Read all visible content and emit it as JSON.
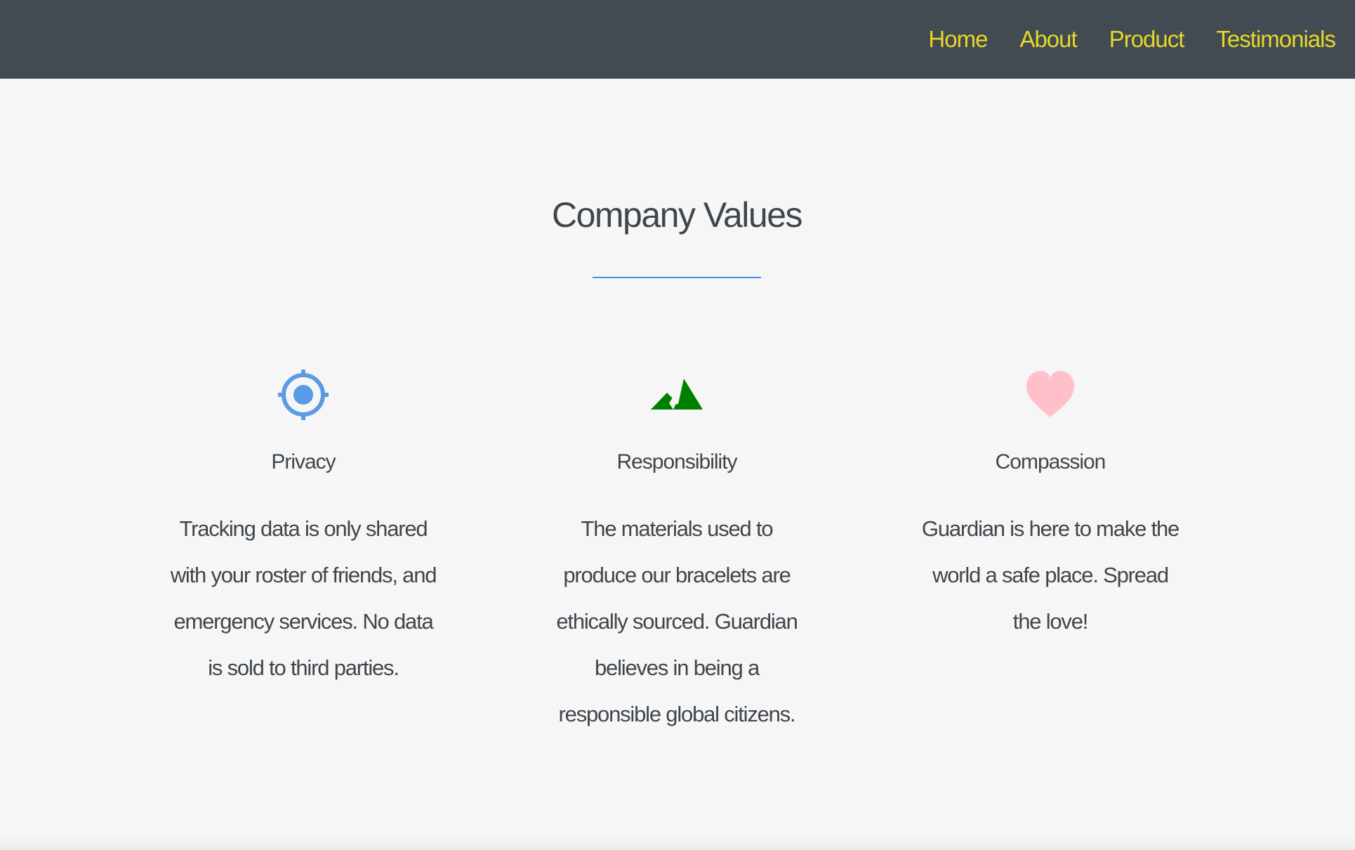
{
  "nav": {
    "links": [
      "Home",
      "About",
      "Product",
      "Testimonials"
    ]
  },
  "values_section": {
    "title": "Company Values",
    "cards": [
      {
        "icon": "crosshair-icon",
        "title": "Privacy",
        "text": "Tracking data is only shared with your roster of friends, and emergency services. No data is sold to third parties."
      },
      {
        "icon": "mountain-icon",
        "title": "Responsibility",
        "text": "The materials used to produce our bracelets are ethically sourced. Guardian believes in being a responsible global citizens."
      },
      {
        "icon": "heart-icon",
        "title": "Compassion",
        "text": "Guardian is here to make the world a safe place. Spread the love!"
      }
    ]
  },
  "colors": {
    "navbar_bg": "#424a52",
    "nav_link": "#e6d829",
    "accent_blue": "#4a90e2",
    "mountain_green": "#008000",
    "heart_pink": "#ffc0cb",
    "text": "#3e464d",
    "page_bg": "#f6f6f6"
  }
}
